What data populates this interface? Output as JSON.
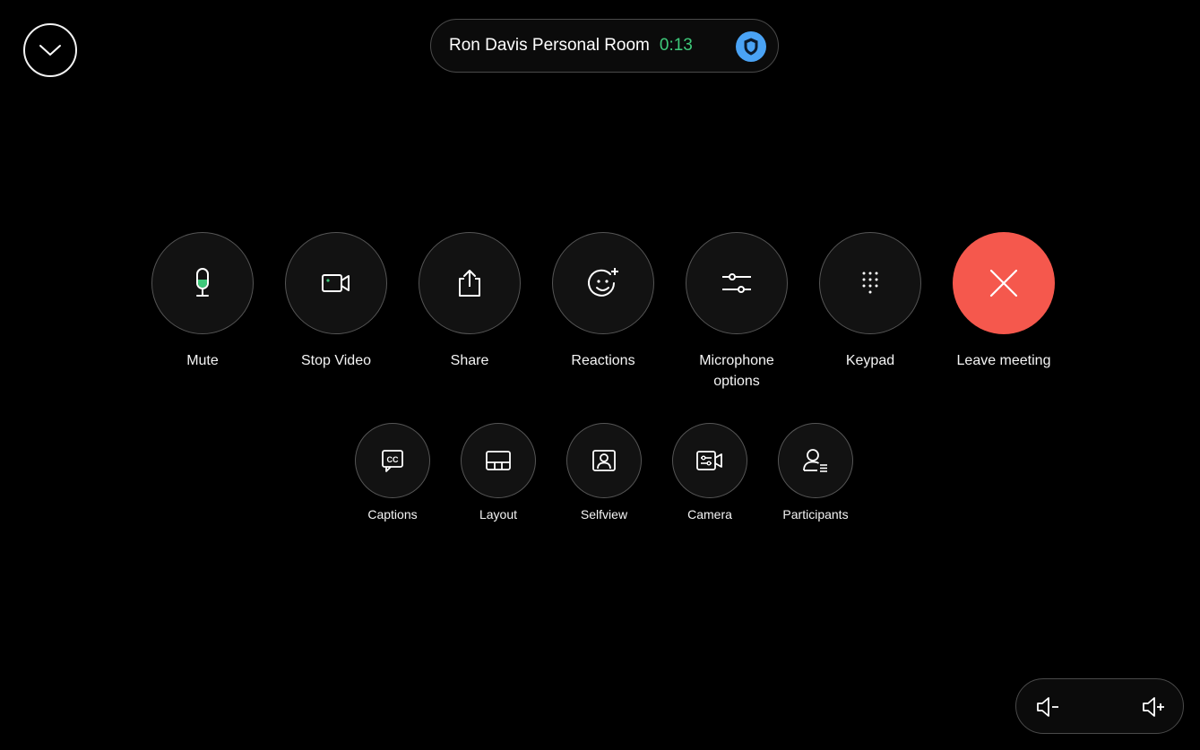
{
  "header": {
    "collapse_icon": "chevron-down-icon",
    "meeting_name": "Ron Davis Personal Room",
    "timer": "0:13",
    "security_icon": "shield-icon"
  },
  "primary_controls": [
    {
      "label": "Mute",
      "icon": "microphone-icon"
    },
    {
      "label": "Stop Video",
      "icon": "video-camera-icon"
    },
    {
      "label": "Share",
      "icon": "share-icon"
    },
    {
      "label": "Reactions",
      "icon": "smiley-add-icon"
    },
    {
      "label": "Microphone\noptions",
      "icon": "sliders-icon"
    },
    {
      "label": "Keypad",
      "icon": "keypad-icon"
    },
    {
      "label": "Leave meeting",
      "icon": "close-icon"
    }
  ],
  "secondary_controls": [
    {
      "label": "Captions",
      "icon": "closed-captions-icon"
    },
    {
      "label": "Layout",
      "icon": "layout-icon"
    },
    {
      "label": "Selfview",
      "icon": "selfview-icon"
    },
    {
      "label": "Camera",
      "icon": "camera-settings-icon"
    },
    {
      "label": "Participants",
      "icon": "participants-icon"
    }
  ],
  "volume": {
    "down_icon": "volume-down-icon",
    "up_icon": "volume-up-icon"
  },
  "colors": {
    "background": "#000000",
    "timer": "#3ec97a",
    "leave": "#f5584d",
    "shield": "#4aa3f5",
    "mic_level": "#3ec97a"
  }
}
